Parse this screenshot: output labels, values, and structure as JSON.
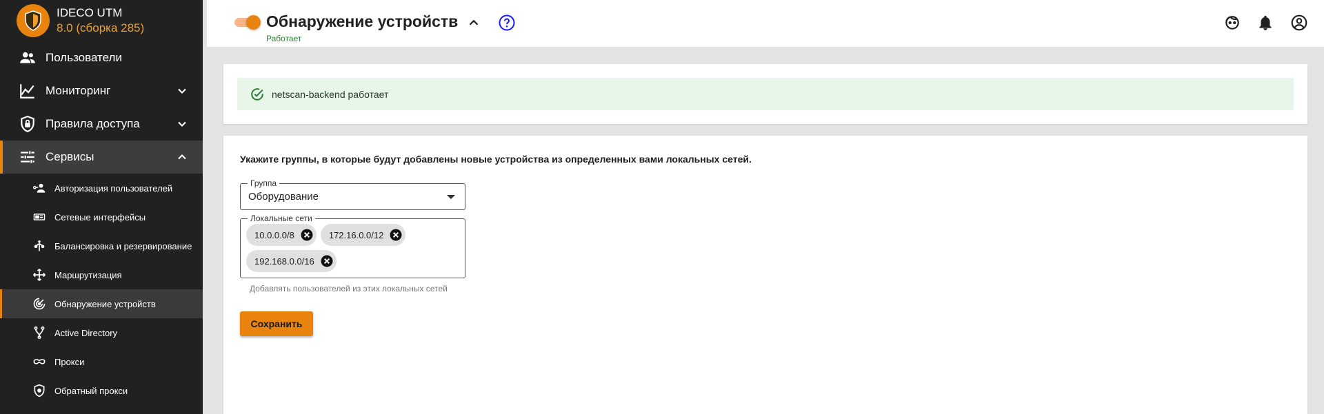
{
  "app": {
    "name": "IDECO UTM",
    "version": "8.0 (сборка 285)"
  },
  "sidebar": {
    "items": [
      {
        "label": "Пользователи",
        "icon": "users-icon"
      },
      {
        "label": "Мониторинг",
        "icon": "chart-line-icon"
      },
      {
        "label": "Правила доступа",
        "icon": "shield-lock-icon"
      },
      {
        "label": "Сервисы",
        "icon": "tune-icon"
      }
    ],
    "subitems": [
      {
        "label": "Авторизация пользователей",
        "icon": "user-key-icon"
      },
      {
        "label": "Сетевые интерфейсы",
        "icon": "network-card-icon"
      },
      {
        "label": "Балансировка и резервирование",
        "icon": "balance-icon"
      },
      {
        "label": "Маршрутизация",
        "icon": "routing-icon"
      },
      {
        "label": "Обнаружение устройств",
        "icon": "radar-icon"
      },
      {
        "label": "Active Directory",
        "icon": "directory-tree-icon"
      },
      {
        "label": "Прокси",
        "icon": "mask-icon"
      },
      {
        "label": "Обратный прокси",
        "icon": "shield-globe-icon"
      }
    ]
  },
  "header": {
    "title": "Обнаружение устройств",
    "status": "Работает",
    "toggle_on": true
  },
  "alert": {
    "text": "netscan-backend работает"
  },
  "form": {
    "description": "Укажите группы, в которые будут добавлены новые устройства из определенных вами локальных сетей.",
    "group_label": "Группа",
    "group_value": "Оборудование",
    "networks_label": "Локальные сети",
    "networks": [
      "10.0.0.0/8",
      "172.16.0.0/12",
      "192.168.0.0/16"
    ],
    "helper": "Добавлять пользователей из этих локальных сетей",
    "save_label": "Сохранить"
  },
  "colors": {
    "accent": "#e8840e",
    "sidebar_bg": "#212121",
    "success_bg": "#e8f5e9",
    "success_text": "#2e7d32",
    "help": "#1a1aff"
  }
}
